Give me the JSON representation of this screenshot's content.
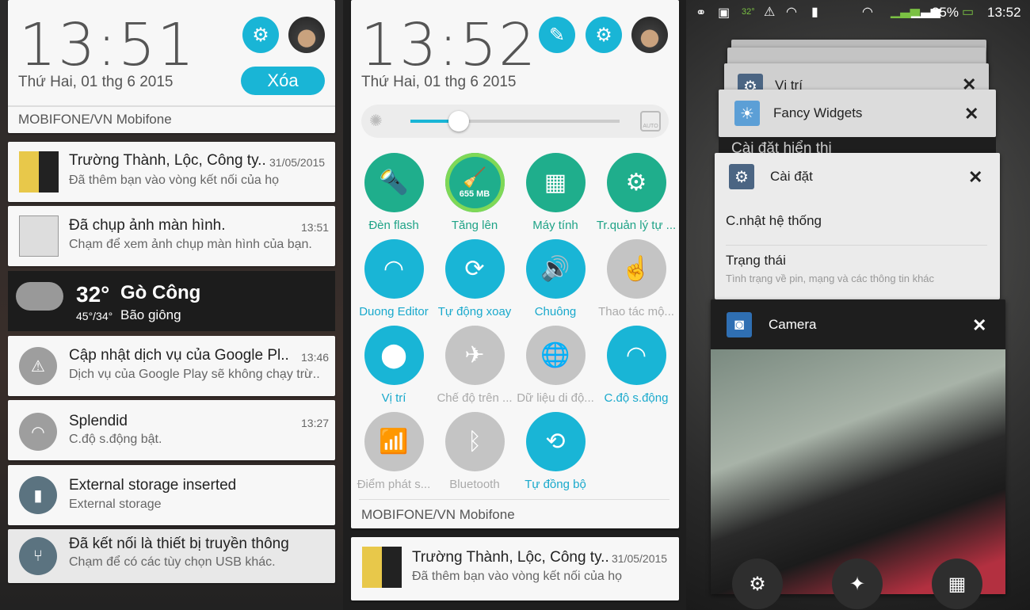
{
  "panel1": {
    "clock": "13:51",
    "date": "Thứ Hai, 01 thg 6 2015",
    "clear_label": "Xóa",
    "carrier": "MOBIFONE/VN Mobifone",
    "notifications": [
      {
        "title": "Trường Thành, Lộc, Công ty..",
        "time": "31/05/2015",
        "text": "Đã thêm bạn vào vòng kết nối của họ",
        "icon": "google-plus-icon"
      },
      {
        "title": "Đã chụp ảnh màn hình.",
        "time": "13:51",
        "text": "Chạm để xem ảnh chụp màn hình của bạn.",
        "icon": "screenshot-icon"
      },
      {
        "title": "Cập nhật dịch vụ của Google Pl..",
        "time": "13:46",
        "text": "Dịch vụ của Google Play sẽ không chạy trừ..",
        "icon": "warning-icon"
      },
      {
        "title": "Splendid",
        "time": "13:27",
        "text": "C.độ s.động bật.",
        "icon": "splendid-icon"
      },
      {
        "title": "External storage inserted",
        "time": "",
        "text": "External storage",
        "icon": "sd-card-icon"
      },
      {
        "title": "Đã kết nối là thiết bị truyền thông",
        "time": "",
        "text": "Chạm để có các tùy chọn USB khác.",
        "icon": "usb-icon"
      }
    ],
    "weather": {
      "temp": "32°",
      "city": "Gò Công",
      "range": "45°/34°",
      "condition": "Bão giông"
    }
  },
  "panel2": {
    "clock": "13:52",
    "date": "Thứ Hai, 01 thg 6 2015",
    "carrier": "MOBIFONE/VN Mobifone",
    "brightness": 0.23,
    "auto_label": "AUTO",
    "boost_value": "655 MB",
    "tiles": [
      {
        "label": "Đèn flash",
        "state": "green",
        "icon": "flashlight-icon",
        "glyph": "🔦"
      },
      {
        "label": "Tăng lên",
        "state": "green",
        "icon": "boost-icon",
        "glyph": ""
      },
      {
        "label": "Máy tính",
        "state": "green",
        "icon": "calculator-icon",
        "glyph": "▦"
      },
      {
        "label": "Tr.quản lý tự ...",
        "state": "green",
        "icon": "auto-start-manager-icon",
        "glyph": "⚙"
      },
      {
        "label": "Duong Editor",
        "state": "on",
        "icon": "wifi-icon",
        "glyph": "◠"
      },
      {
        "label": "Tự động xoay",
        "state": "on",
        "icon": "auto-rotate-icon",
        "glyph": "⟳"
      },
      {
        "label": "Chuông",
        "state": "on",
        "icon": "sound-icon",
        "glyph": "🔊"
      },
      {
        "label": "Thao tác mộ...",
        "state": "off",
        "icon": "one-hand-icon",
        "glyph": "☝"
      },
      {
        "label": "Vị trí",
        "state": "on",
        "icon": "location-icon",
        "glyph": "⬤"
      },
      {
        "label": "Chế độ trên ...",
        "state": "off",
        "icon": "airplane-icon",
        "glyph": "✈"
      },
      {
        "label": "Dữ liệu di độ...",
        "state": "off",
        "icon": "mobile-data-icon",
        "glyph": "🌐"
      },
      {
        "label": "C.độ s.động",
        "state": "on",
        "icon": "splendid-icon",
        "glyph": "◠"
      },
      {
        "label": "Điểm phát s...",
        "state": "off",
        "icon": "hotspot-icon",
        "glyph": "📶"
      },
      {
        "label": "Bluetooth",
        "state": "off",
        "icon": "bluetooth-icon",
        "glyph": "ᛒ"
      },
      {
        "label": "Tự đồng bộ",
        "state": "on",
        "icon": "sync-icon",
        "glyph": "⟲"
      }
    ],
    "notification": {
      "title": "Trường Thành, Lộc, Công ty..",
      "time": "31/05/2015",
      "text": "Đã thêm bạn vào vòng kết nối của họ"
    }
  },
  "panel3": {
    "status": {
      "battery": "35%",
      "time": "13:52",
      "temp": "32°"
    },
    "recents": [
      {
        "title": "Vị trí"
      },
      {
        "title": "Fancy Widgets",
        "below": "Cài đặt hiển thị"
      },
      {
        "title": "Cài đặt",
        "items": [
          {
            "title": "C.nhật hệ thống"
          },
          {
            "title": "Trạng thái",
            "sub": "Tình trạng về pin, mạng và các thông tin khác"
          }
        ]
      },
      {
        "title": "Camera"
      }
    ]
  },
  "colors": {
    "accent": "#19b5d6",
    "green": "#1fae8c",
    "off": "#c4c4c4"
  }
}
